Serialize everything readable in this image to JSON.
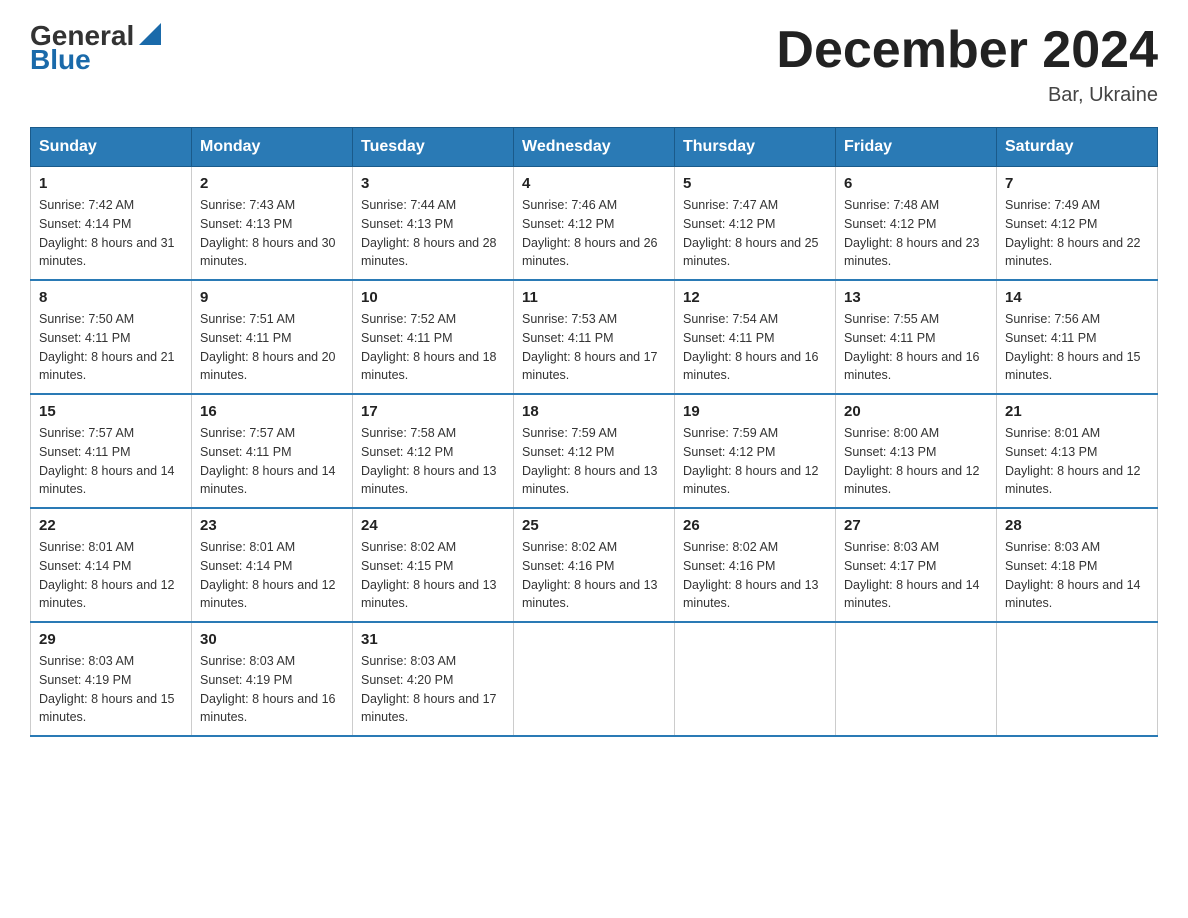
{
  "logo": {
    "general": "General",
    "blue": "Blue",
    "arrow": "▶"
  },
  "title": "December 2024",
  "location": "Bar, Ukraine",
  "days_of_week": [
    "Sunday",
    "Monday",
    "Tuesday",
    "Wednesday",
    "Thursday",
    "Friday",
    "Saturday"
  ],
  "weeks": [
    [
      {
        "day": "1",
        "sunrise": "Sunrise: 7:42 AM",
        "sunset": "Sunset: 4:14 PM",
        "daylight": "Daylight: 8 hours and 31 minutes."
      },
      {
        "day": "2",
        "sunrise": "Sunrise: 7:43 AM",
        "sunset": "Sunset: 4:13 PM",
        "daylight": "Daylight: 8 hours and 30 minutes."
      },
      {
        "day": "3",
        "sunrise": "Sunrise: 7:44 AM",
        "sunset": "Sunset: 4:13 PM",
        "daylight": "Daylight: 8 hours and 28 minutes."
      },
      {
        "day": "4",
        "sunrise": "Sunrise: 7:46 AM",
        "sunset": "Sunset: 4:12 PM",
        "daylight": "Daylight: 8 hours and 26 minutes."
      },
      {
        "day": "5",
        "sunrise": "Sunrise: 7:47 AM",
        "sunset": "Sunset: 4:12 PM",
        "daylight": "Daylight: 8 hours and 25 minutes."
      },
      {
        "day": "6",
        "sunrise": "Sunrise: 7:48 AM",
        "sunset": "Sunset: 4:12 PM",
        "daylight": "Daylight: 8 hours and 23 minutes."
      },
      {
        "day": "7",
        "sunrise": "Sunrise: 7:49 AM",
        "sunset": "Sunset: 4:12 PM",
        "daylight": "Daylight: 8 hours and 22 minutes."
      }
    ],
    [
      {
        "day": "8",
        "sunrise": "Sunrise: 7:50 AM",
        "sunset": "Sunset: 4:11 PM",
        "daylight": "Daylight: 8 hours and 21 minutes."
      },
      {
        "day": "9",
        "sunrise": "Sunrise: 7:51 AM",
        "sunset": "Sunset: 4:11 PM",
        "daylight": "Daylight: 8 hours and 20 minutes."
      },
      {
        "day": "10",
        "sunrise": "Sunrise: 7:52 AM",
        "sunset": "Sunset: 4:11 PM",
        "daylight": "Daylight: 8 hours and 18 minutes."
      },
      {
        "day": "11",
        "sunrise": "Sunrise: 7:53 AM",
        "sunset": "Sunset: 4:11 PM",
        "daylight": "Daylight: 8 hours and 17 minutes."
      },
      {
        "day": "12",
        "sunrise": "Sunrise: 7:54 AM",
        "sunset": "Sunset: 4:11 PM",
        "daylight": "Daylight: 8 hours and 16 minutes."
      },
      {
        "day": "13",
        "sunrise": "Sunrise: 7:55 AM",
        "sunset": "Sunset: 4:11 PM",
        "daylight": "Daylight: 8 hours and 16 minutes."
      },
      {
        "day": "14",
        "sunrise": "Sunrise: 7:56 AM",
        "sunset": "Sunset: 4:11 PM",
        "daylight": "Daylight: 8 hours and 15 minutes."
      }
    ],
    [
      {
        "day": "15",
        "sunrise": "Sunrise: 7:57 AM",
        "sunset": "Sunset: 4:11 PM",
        "daylight": "Daylight: 8 hours and 14 minutes."
      },
      {
        "day": "16",
        "sunrise": "Sunrise: 7:57 AM",
        "sunset": "Sunset: 4:11 PM",
        "daylight": "Daylight: 8 hours and 14 minutes."
      },
      {
        "day": "17",
        "sunrise": "Sunrise: 7:58 AM",
        "sunset": "Sunset: 4:12 PM",
        "daylight": "Daylight: 8 hours and 13 minutes."
      },
      {
        "day": "18",
        "sunrise": "Sunrise: 7:59 AM",
        "sunset": "Sunset: 4:12 PM",
        "daylight": "Daylight: 8 hours and 13 minutes."
      },
      {
        "day": "19",
        "sunrise": "Sunrise: 7:59 AM",
        "sunset": "Sunset: 4:12 PM",
        "daylight": "Daylight: 8 hours and 12 minutes."
      },
      {
        "day": "20",
        "sunrise": "Sunrise: 8:00 AM",
        "sunset": "Sunset: 4:13 PM",
        "daylight": "Daylight: 8 hours and 12 minutes."
      },
      {
        "day": "21",
        "sunrise": "Sunrise: 8:01 AM",
        "sunset": "Sunset: 4:13 PM",
        "daylight": "Daylight: 8 hours and 12 minutes."
      }
    ],
    [
      {
        "day": "22",
        "sunrise": "Sunrise: 8:01 AM",
        "sunset": "Sunset: 4:14 PM",
        "daylight": "Daylight: 8 hours and 12 minutes."
      },
      {
        "day": "23",
        "sunrise": "Sunrise: 8:01 AM",
        "sunset": "Sunset: 4:14 PM",
        "daylight": "Daylight: 8 hours and 12 minutes."
      },
      {
        "day": "24",
        "sunrise": "Sunrise: 8:02 AM",
        "sunset": "Sunset: 4:15 PM",
        "daylight": "Daylight: 8 hours and 13 minutes."
      },
      {
        "day": "25",
        "sunrise": "Sunrise: 8:02 AM",
        "sunset": "Sunset: 4:16 PM",
        "daylight": "Daylight: 8 hours and 13 minutes."
      },
      {
        "day": "26",
        "sunrise": "Sunrise: 8:02 AM",
        "sunset": "Sunset: 4:16 PM",
        "daylight": "Daylight: 8 hours and 13 minutes."
      },
      {
        "day": "27",
        "sunrise": "Sunrise: 8:03 AM",
        "sunset": "Sunset: 4:17 PM",
        "daylight": "Daylight: 8 hours and 14 minutes."
      },
      {
        "day": "28",
        "sunrise": "Sunrise: 8:03 AM",
        "sunset": "Sunset: 4:18 PM",
        "daylight": "Daylight: 8 hours and 14 minutes."
      }
    ],
    [
      {
        "day": "29",
        "sunrise": "Sunrise: 8:03 AM",
        "sunset": "Sunset: 4:19 PM",
        "daylight": "Daylight: 8 hours and 15 minutes."
      },
      {
        "day": "30",
        "sunrise": "Sunrise: 8:03 AM",
        "sunset": "Sunset: 4:19 PM",
        "daylight": "Daylight: 8 hours and 16 minutes."
      },
      {
        "day": "31",
        "sunrise": "Sunrise: 8:03 AM",
        "sunset": "Sunset: 4:20 PM",
        "daylight": "Daylight: 8 hours and 17 minutes."
      },
      null,
      null,
      null,
      null
    ]
  ]
}
